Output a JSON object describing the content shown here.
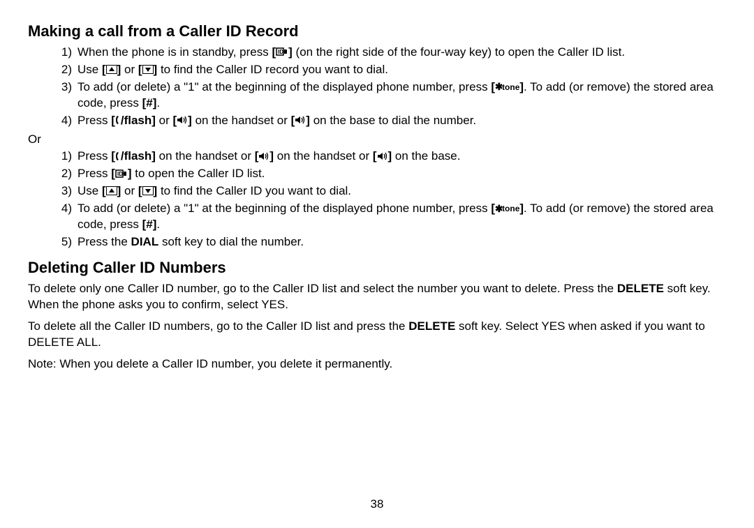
{
  "page_number": "38",
  "h1": "Making a call from a Caller ID Record",
  "h2": "Deleting Caller ID Numbers",
  "list1": {
    "i1a": "When the phone is in standby, press ",
    "i1b": " (on the right side of the four-way key) to open the Caller ID list.",
    "i2a": "Use ",
    "i2b": " or ",
    "i2c": " to find the Caller ID record you want to dial.",
    "i3a": "To add (or delete) a \"1\" at the beginning of the displayed phone number, press ",
    "i3b": ". To add (or remove) the stored area code, press ",
    "i3c": ".",
    "i4a": "Press ",
    "i4b": " or ",
    "i4c": " on the handset or ",
    "i4d": " on the base to dial the number."
  },
  "or": "Or",
  "list2": {
    "i1a": "Press ",
    "i1b": " on the handset or ",
    "i1c": " on the handset or ",
    "i1d": " on the base.",
    "i2a": "Press ",
    "i2b": " to open the Caller ID list.",
    "i3a": "Use ",
    "i3b": " or ",
    "i3c": " to find the Caller ID you want to dial.",
    "i4a": "To add (or delete) a \"1\" at the beginning of the displayed phone number, press ",
    "i4b": ". To add (or remove) the stored area code, press ",
    "i4c": ".",
    "i5a": "Press the ",
    "i5b": "DIAL",
    "i5c": " soft key to dial the number."
  },
  "del": {
    "p1a": "To delete only one Caller ID number, go to the Caller ID list and select the number you want to delete. Press the ",
    "p1b": "DE­LETE",
    "p1c": " soft key. When the phone asks you to confirm, select YES.",
    "p2a": "To delete all the Caller ID numbers, go to the Caller ID list and press the ",
    "p2b": "DELETE",
    "p2c": " soft key. Select YES when asked if you want to DELETE ALL.",
    "p3": "Note: When you delete a Caller ID number, you delete it permanently."
  },
  "keys": {
    "flash": "/flash",
    "hash": "[#]",
    "tone": "tone"
  }
}
